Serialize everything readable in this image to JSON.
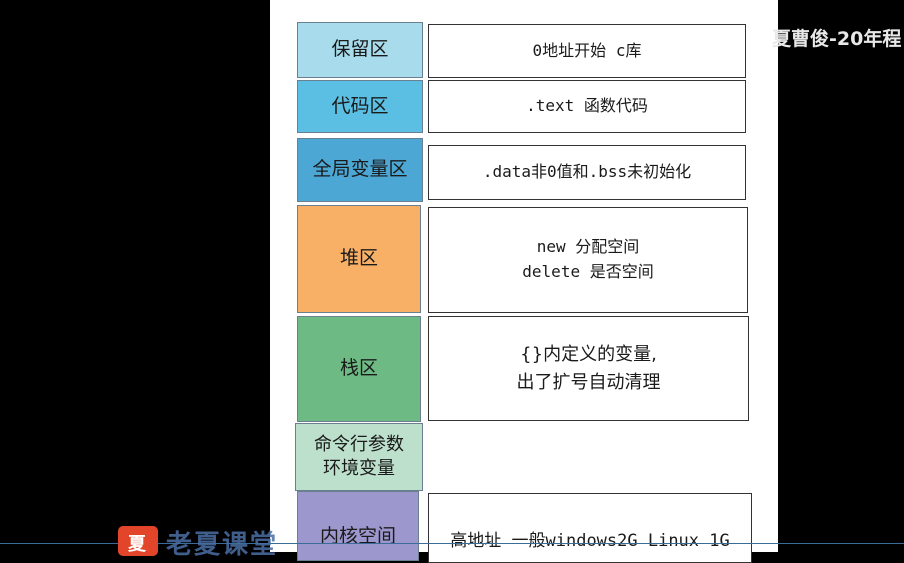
{
  "author_watermark": "夏曹俊-20年程",
  "diagram": {
    "segments": [
      {
        "label": "保留区",
        "desc": "0地址开始 c库",
        "color": "#a8dcec"
      },
      {
        "label": "代码区",
        "desc": ".text 函数代码",
        "color": "#5bbfe3"
      },
      {
        "label": "全局变量区",
        "desc": ".data非0值和.bss未初始化",
        "color": "#4ca7d4"
      },
      {
        "label": "堆区",
        "desc": "new 分配空间\ndelete 是否空间",
        "color": "#f8b066"
      },
      {
        "label": "栈区",
        "desc": "{}内定义的变量,\n出了扩号自动清理",
        "color": "#6dba84"
      },
      {
        "label": "命令行参数\n环境变量",
        "desc": "",
        "color": "#bde0cc"
      },
      {
        "label": "内核空间",
        "desc": "高地址 一般windows2G Linux 1G",
        "color": "#9c97cc"
      }
    ]
  },
  "brand": {
    "logo_text": "老夏课堂",
    "logo_mark": "夏"
  }
}
